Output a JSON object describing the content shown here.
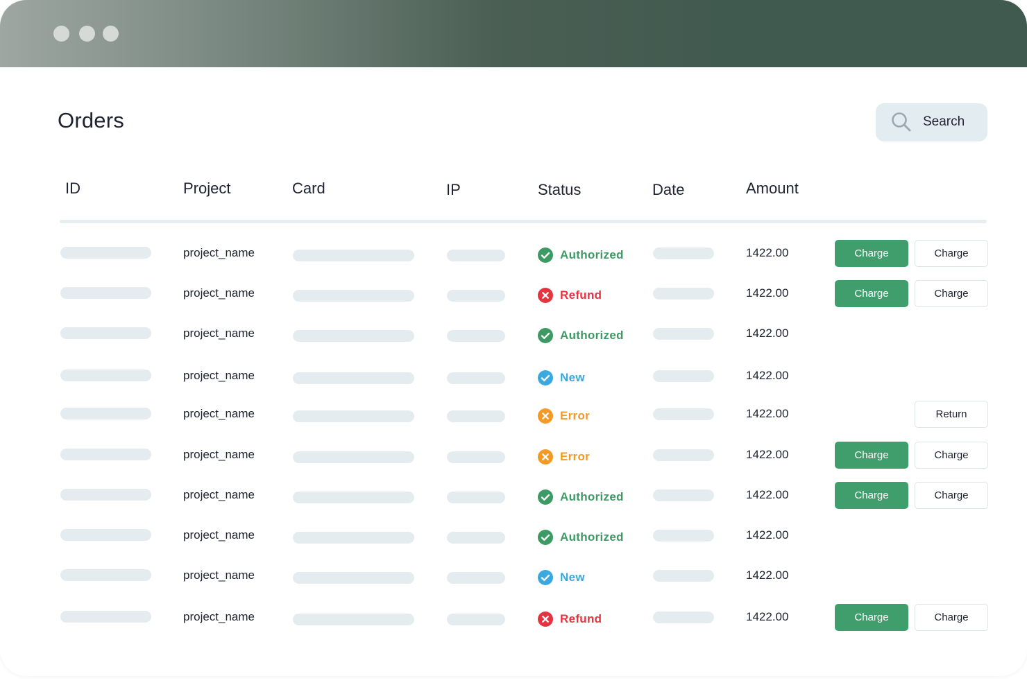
{
  "window": {
    "controls": [
      "close-dot",
      "minimize-dot",
      "maximize-dot"
    ]
  },
  "header": {
    "title": "Orders",
    "search_label": "Search"
  },
  "table": {
    "columns": [
      "ID",
      "Project",
      "Card",
      "IP",
      "Status",
      "Date",
      "Amount"
    ],
    "rows": [
      {
        "project": "project_name",
        "status": "Authorized",
        "amount": "1422.00",
        "primary": "Charge",
        "secondary": "Charge"
      },
      {
        "project": "project_name",
        "status": "Refund",
        "amount": "1422.00",
        "primary": "Charge",
        "secondary": "Charge"
      },
      {
        "project": "project_name",
        "status": "Authorized",
        "amount": "1422.00",
        "primary": "",
        "secondary": ""
      },
      {
        "project": "project_name",
        "status": "New",
        "amount": "1422.00",
        "primary": "",
        "secondary": ""
      },
      {
        "project": "project_name",
        "status": "Error",
        "amount": "1422.00",
        "primary": "",
        "secondary": "Return"
      },
      {
        "project": "project_name",
        "status": "Error",
        "amount": "1422.00",
        "primary": "Charge",
        "secondary": "Charge"
      },
      {
        "project": "project_name",
        "status": "Authorized",
        "amount": "1422.00",
        "primary": "Charge",
        "secondary": "Charge"
      },
      {
        "project": "project_name",
        "status": "Authorized",
        "amount": "1422.00",
        "primary": "",
        "secondary": ""
      },
      {
        "project": "project_name",
        "status": "New",
        "amount": "1422.00",
        "primary": "",
        "secondary": ""
      },
      {
        "project": "project_name",
        "status": "Refund",
        "amount": "1422.00",
        "primary": "Charge",
        "secondary": "Charge"
      }
    ]
  },
  "status_styles": {
    "Authorized": {
      "color": "#3d9a64",
      "icon": "check-circle-icon"
    },
    "Refund": {
      "color": "#e5333f",
      "icon": "x-circle-icon"
    },
    "New": {
      "color": "#3aa9df",
      "icon": "check-circle-icon"
    },
    "Error": {
      "color": "#f29a25",
      "icon": "x-circle-icon"
    }
  },
  "colors": {
    "accent": "#3f9e6b",
    "title_bar": "#405a4f",
    "placeholder": "#e4ecf0"
  }
}
